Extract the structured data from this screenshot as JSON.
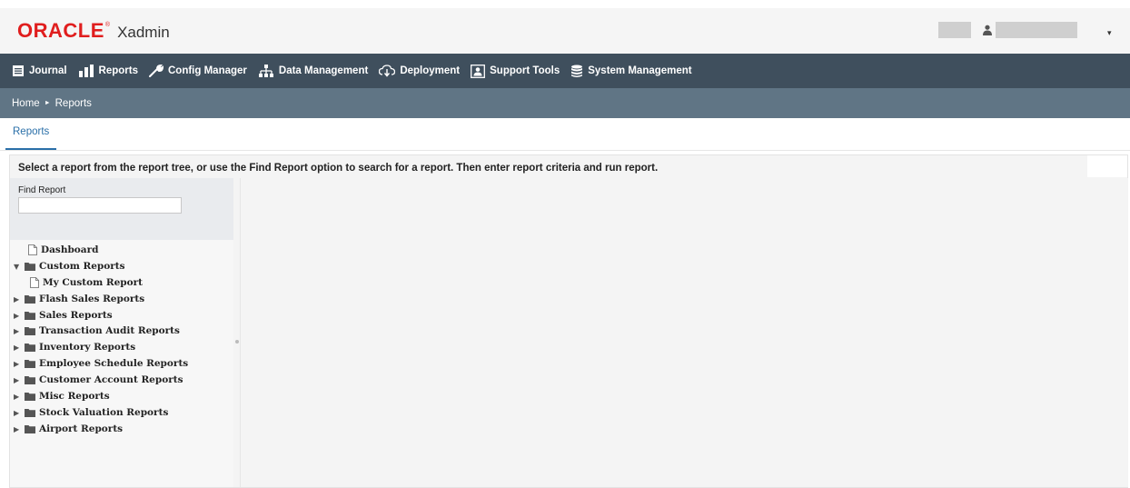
{
  "header": {
    "brand": "ORACLE",
    "product": "Xadmin",
    "user_caret": "▾"
  },
  "nav": {
    "items": [
      {
        "label": "Journal",
        "icon": "journal-icon"
      },
      {
        "label": "Reports",
        "icon": "reports-icon"
      },
      {
        "label": "Config Manager",
        "icon": "wrench-icon"
      },
      {
        "label": "Data Management",
        "icon": "hierarchy-icon"
      },
      {
        "label": "Deployment",
        "icon": "cloud-download-icon"
      },
      {
        "label": "Support Tools",
        "icon": "support-icon"
      },
      {
        "label": "System Management",
        "icon": "database-icon"
      }
    ]
  },
  "breadcrumb": {
    "home": "Home",
    "separator": "►",
    "current": "Reports"
  },
  "tabs": {
    "active": "Reports"
  },
  "content": {
    "instructions": "Select a report from the report tree, or use the Find Report option to search for a report. Then enter report criteria and run report.",
    "find_label": "Find Report",
    "find_value": ""
  },
  "tree": [
    {
      "label": "Dashboard",
      "type": "file",
      "level": 0
    },
    {
      "label": "Custom Reports",
      "type": "folder",
      "expanded": true,
      "level": 0
    },
    {
      "label": "My Custom Report",
      "type": "file",
      "level": 1
    },
    {
      "label": "Flash Sales Reports",
      "type": "folder",
      "expanded": false,
      "level": 0
    },
    {
      "label": "Sales Reports",
      "type": "folder",
      "expanded": false,
      "level": 0
    },
    {
      "label": "Transaction Audit Reports",
      "type": "folder",
      "expanded": false,
      "level": 0
    },
    {
      "label": "Inventory Reports",
      "type": "folder",
      "expanded": false,
      "level": 0
    },
    {
      "label": "Employee Schedule Reports",
      "type": "folder",
      "expanded": false,
      "level": 0
    },
    {
      "label": "Customer Account Reports",
      "type": "folder",
      "expanded": false,
      "level": 0
    },
    {
      "label": "Misc Reports",
      "type": "folder",
      "expanded": false,
      "level": 0
    },
    {
      "label": "Stock Valuation Reports",
      "type": "folder",
      "expanded": false,
      "level": 0
    },
    {
      "label": "Airport Reports",
      "type": "folder",
      "expanded": false,
      "level": 0
    }
  ],
  "colors": {
    "brand_red": "#e01e1e",
    "nav_bg": "#3f4f5d",
    "breadcrumb_bg": "#607585",
    "tab_accent": "#2a6fa8"
  }
}
